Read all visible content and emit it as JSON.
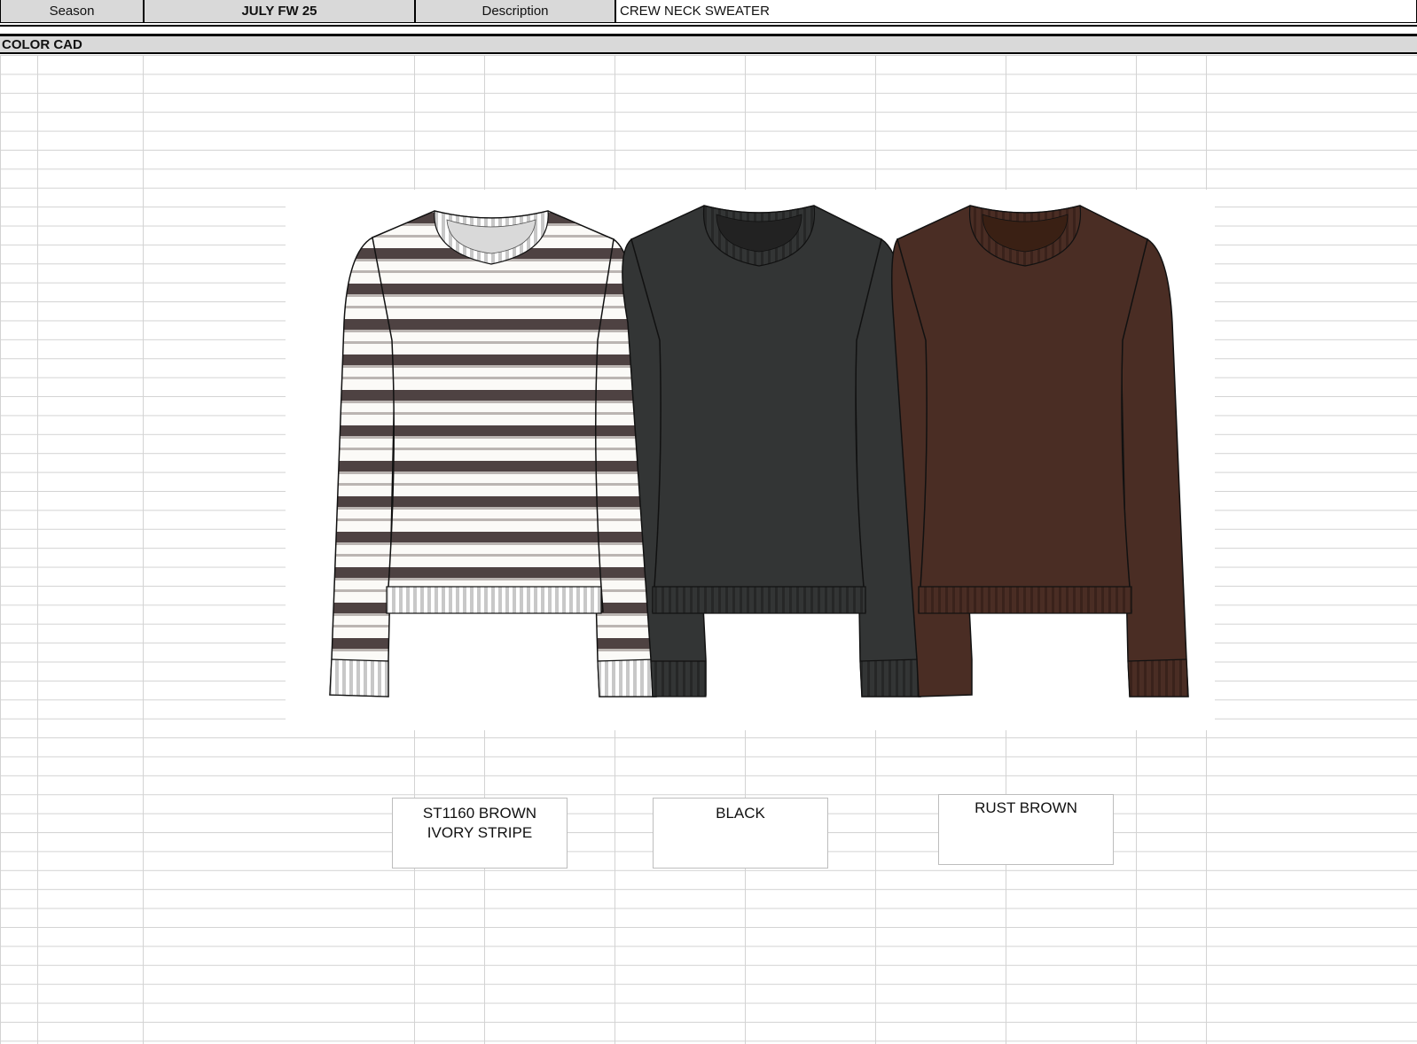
{
  "header": {
    "season_label": "Season",
    "season_value": "JULY FW 25",
    "description_label": "Description",
    "description_value": "CREW NECK SWEATER"
  },
  "section": {
    "title": "COLOR CAD"
  },
  "colorways": [
    {
      "name_line1": "ST1160 BROWN",
      "name_line2": "IVORY STRIPE",
      "body_color": "#ffffff",
      "stripe_color": "#4e4242",
      "trim_color": "#c8c8c8"
    },
    {
      "name_line1": "BLACK",
      "name_line2": "",
      "body_color": "#333535",
      "trim_color": "#2a2b2b"
    },
    {
      "name_line1": "RUST BROWN",
      "name_line2": "",
      "body_color": "#4a2d24",
      "trim_color": "#3e241c"
    }
  ]
}
